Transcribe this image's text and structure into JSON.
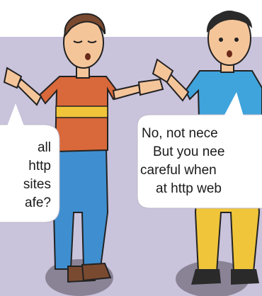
{
  "scene": {
    "background_color": "#c9c3dc",
    "left_bubble": {
      "lines": [
        "all",
        "http",
        "sites",
        "afe?"
      ]
    },
    "right_bubble": {
      "lines": [
        "No, not nece",
        "But you nee",
        "careful when",
        "at http web"
      ]
    },
    "colors": {
      "shirt_left": "#d9683a",
      "shirt_stripe": "#f0c53a",
      "pants_left": "#3f8fd0",
      "shirt_right": "#3fa3dc",
      "pants_right": "#f0c53a",
      "skin": "#f5c59a",
      "hair": "#2a2a2a",
      "shadow": "#8a8395"
    }
  }
}
